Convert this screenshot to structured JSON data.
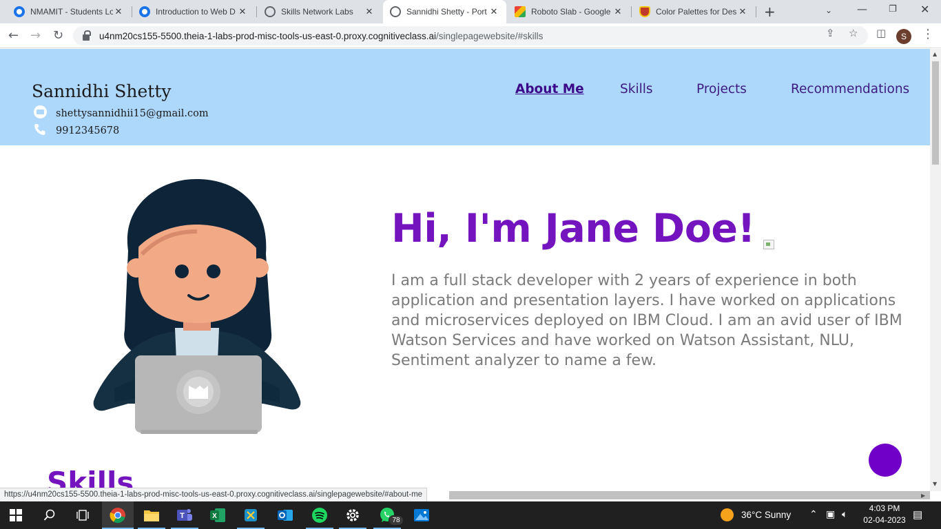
{
  "browser": {
    "tabs": [
      {
        "label": "NMAMIT - Students Lo",
        "icon": "chrome-c-icon"
      },
      {
        "label": "Introduction to Web D",
        "icon": "chrome-c-icon"
      },
      {
        "label": "Skills Network Labs",
        "icon": "globe-icon"
      },
      {
        "label": "Sannidhi Shetty - Port",
        "icon": "globe-icon"
      },
      {
        "label": "Roboto Slab - Google",
        "icon": "google-fonts-icon"
      },
      {
        "label": "Color Palettes for Des",
        "icon": "palette-cup-icon"
      }
    ],
    "active_tab": 3,
    "url_host": "u4nm20cs155-5500.theia-1-labs-prod-misc-tools-us-east-0.proxy.cognitiveclass.ai",
    "url_path": "/singlepagewebsite/#skills",
    "profile_initial": "S",
    "status_url": "https://u4nm20cs155-5500.theia-1-labs-prod-misc-tools-us-east-0.proxy.cognitiveclass.ai/singlepagewebsite/#about-me"
  },
  "site": {
    "name": "Sannidhi Shetty",
    "email": "shettysannidhii15@gmail.com",
    "phone": "9912345678",
    "nav": [
      "About Me",
      "Skills",
      "Projects",
      "Recommendations"
    ],
    "current_nav": "About Me",
    "hero_title": "Hi, I'm Jane Doe!",
    "hero_text": "I am a full stack developer with 2 years of experience in both application and presentation layers. I have worked on applications and microservices deployed on IBM Cloud. I am an avid user of IBM Watson Services and have worked on Watson Assistant, NLU, Sentiment analyzer to name a few.",
    "skills_heading": "Skills"
  },
  "colors": {
    "header_bg": "#add8fc",
    "accent": "#7414bf",
    "nav_text": "#3d1a82",
    "body_text": "#7a7a7a"
  },
  "taskbar": {
    "apps": [
      "chrome-icon",
      "file-explorer-icon",
      "teams-icon",
      "excel-icon",
      "snipping-icon",
      "outlook-icon",
      "spotify-icon",
      "settings-icon",
      "whatsapp-icon",
      "photos-icon"
    ],
    "whatsapp_badge": "78",
    "weather": "36°C  Sunny",
    "time": "4:03 PM",
    "date": "02-04-2023"
  }
}
